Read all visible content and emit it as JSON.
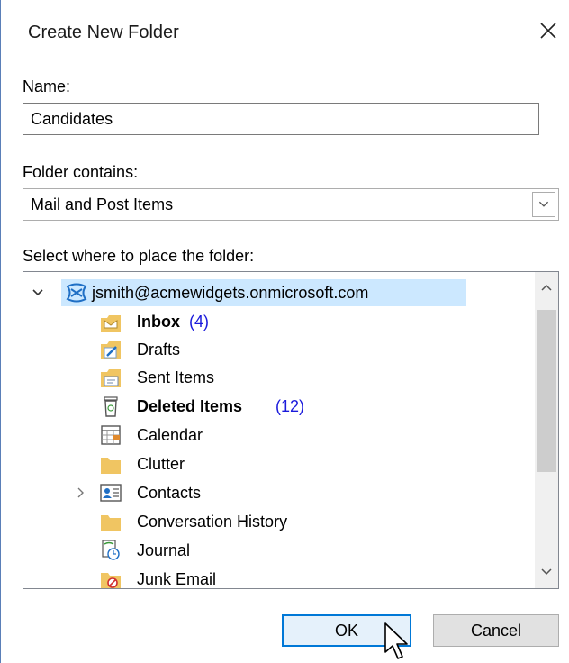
{
  "dialog": {
    "title": "Create New Folder",
    "close_icon": "close-icon"
  },
  "name_field": {
    "label": "Name:",
    "value": "Candidates"
  },
  "folder_contains": {
    "label": "Folder contains:",
    "selected": "Mail and Post Items",
    "arrow_icon": "chevron-down-icon"
  },
  "placement": {
    "label": "Select where to place the folder:",
    "account": "jsmith@acmewidgets.onmicrosoft.com",
    "folders": [
      {
        "label": "Inbox",
        "count": "(4)",
        "bold": true,
        "icon": "inbox-icon"
      },
      {
        "label": "Drafts",
        "count": "",
        "bold": false,
        "icon": "drafts-icon"
      },
      {
        "label": "Sent Items",
        "count": "",
        "bold": false,
        "icon": "sent-items-icon"
      },
      {
        "label": "Deleted Items",
        "count": "(12)",
        "bold": true,
        "icon": "trash-icon"
      },
      {
        "label": "Calendar",
        "count": "",
        "bold": false,
        "icon": "calendar-icon"
      },
      {
        "label": "Clutter",
        "count": "",
        "bold": false,
        "icon": "folder-icon"
      },
      {
        "label": "Contacts",
        "count": "",
        "bold": false,
        "icon": "contacts-icon",
        "expandable": true
      },
      {
        "label": "Conversation History",
        "count": "",
        "bold": false,
        "icon": "folder-icon"
      },
      {
        "label": "Journal",
        "count": "",
        "bold": false,
        "icon": "journal-icon"
      },
      {
        "label": "Junk Email",
        "count": "",
        "bold": false,
        "icon": "junk-email-icon"
      }
    ]
  },
  "buttons": {
    "ok": "OK",
    "cancel": "Cancel"
  },
  "colors": {
    "accent": "#0078d7",
    "selection": "#cce8ff",
    "count": "#1a1adb",
    "folder": "#f0c562"
  }
}
